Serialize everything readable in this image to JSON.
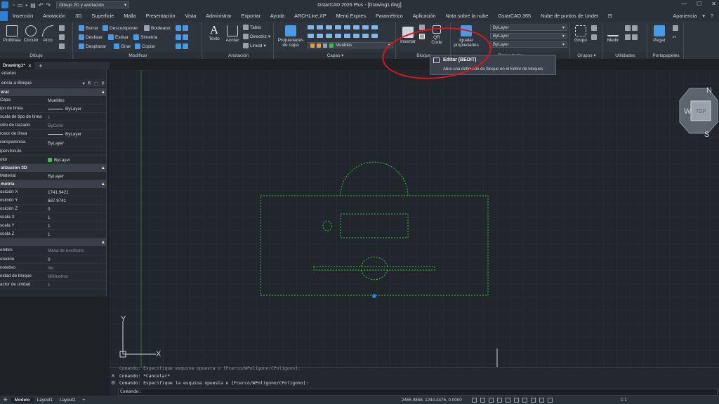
{
  "title_bar": {
    "app_title": "GstarCAD 2026 Plus - [Drawing1.dwg]",
    "workspace": "Dibujo 2D y anotación"
  },
  "menu": {
    "tabs": [
      "Inserción",
      "Anotación",
      "3D",
      "Superficie",
      "Malla",
      "Presentación",
      "Vista",
      "Administrar",
      "Exportar",
      "Ayuda",
      "ARCHLine.XP",
      "Menú Expres",
      "Paramétrico",
      "Aplicación",
      "Nota sobre la nube",
      "GstarCAD 365",
      "Nube de puntos de Undet"
    ],
    "appearance": "Apariencia"
  },
  "ribbon": {
    "dibujo": {
      "title": "Dibujo",
      "polilinea": "Polilínea",
      "circulo": "Círculo",
      "arco": "Arco"
    },
    "modificar": {
      "title": "Modificar",
      "borrar": "Borrar",
      "descomponer": "Descomponer",
      "booleano": "Booleano",
      "desfase": "Desfase",
      "estirar": "Estirar",
      "simetria": "Simetría",
      "desplazar": "Desplazar",
      "girar": "Girar",
      "copiar": "Copiar"
    },
    "anotacion": {
      "title": "Anotación",
      "texto": "Texto",
      "acotar": "Acotar",
      "tabla": "Tabla",
      "directriz": "Directriz",
      "lineal": "Lineal"
    },
    "capas": {
      "title": "Capas",
      "propiedades": "Propiedades de capa",
      "current_layer": "Muebles"
    },
    "bloque": {
      "title": "Bloque",
      "insertar": "Insertar",
      "qr": "QR Code"
    },
    "propiedades": {
      "title": "Propiedades",
      "igualar": "Igualar propiedades",
      "color": "ByLayer",
      "linetype": "ByLayer",
      "lineweight": "ByLayer",
      "layer_color": "ByLayer"
    },
    "grupos": {
      "title": "Grupos",
      "grupo": "Grupo"
    },
    "utilidades": {
      "title": "Utilidades",
      "medir": "Medir"
    },
    "portapapeles": {
      "title": "Portapapeles",
      "pegar": "Pegar"
    }
  },
  "tooltip": {
    "title": "Editar (BEDIT)",
    "description": "Abre una definición de bloque en el Editor de bloques"
  },
  "doc_tab": {
    "name": "Drawing1*"
  },
  "properties": {
    "header": "edades",
    "selection": "encia a Bloque",
    "sections": [
      {
        "name": "eral",
        "rows": [
          {
            "k": "Capa",
            "v": "Muebles"
          },
          {
            "k": "ipo de línea",
            "v": "ByLayer"
          },
          {
            "k": "scala de tipo de línea",
            "v": "1",
            "dim": true
          },
          {
            "k": "stilo de trazado",
            "v": "ByColor",
            "dim": true
          },
          {
            "k": "rosor de línea",
            "v": "ByLayer"
          },
          {
            "k": "ransparencia",
            "v": "ByLayer"
          },
          {
            "k": "ipervínculo",
            "v": ""
          },
          {
            "k": "olor",
            "v": "ByLayer"
          }
        ]
      },
      {
        "name": "alización 3D",
        "rows": [
          {
            "k": "Material",
            "v": "ByLayer"
          }
        ]
      },
      {
        "name": "metría",
        "rows": [
          {
            "k": "osición X",
            "v": "1741.9421"
          },
          {
            "k": "osición Y",
            "v": "687.9741"
          },
          {
            "k": "osición Z",
            "v": "0"
          },
          {
            "k": "scala X",
            "v": "1"
          },
          {
            "k": "scala Y",
            "v": "1"
          },
          {
            "k": "scala Z",
            "v": "1"
          }
        ]
      },
      {
        "name": "",
        "rows": [
          {
            "k": "ombre",
            "v": "Mesa de escritorio",
            "dim": true
          },
          {
            "k": "otación",
            "v": "0"
          },
          {
            "k": "notativo",
            "v": "No",
            "dim": true
          },
          {
            "k": "nidad de bloque",
            "v": "Milímetros",
            "dim": true
          },
          {
            "k": "actor de unidad",
            "v": "1",
            "dim": true
          }
        ]
      }
    ]
  },
  "viewcube": {
    "top": "TOP",
    "n": "N",
    "s": "S",
    "w": "W"
  },
  "ucs": {
    "x": "X",
    "y": "Y"
  },
  "command": {
    "history": [
      "Comando: Especifique esquina opuesta o [Fcerco/WPolígono/CPolígono]:",
      "Comando: *Cancelar*",
      "Comando: Especifique la esquina opuesta o [Fcerco/WPolígono/CPolígono]:"
    ],
    "prompt": "Comando:"
  },
  "status": {
    "tabs": [
      "Modelo",
      "Layout1",
      "Layout2"
    ],
    "coords": "2465.9858, 1244.4475, 0.0000",
    "scale": "1:1"
  },
  "colors": {
    "accent": "#2f7fd6",
    "entity": "#3fbf4a",
    "highlight": "#e0141b"
  }
}
